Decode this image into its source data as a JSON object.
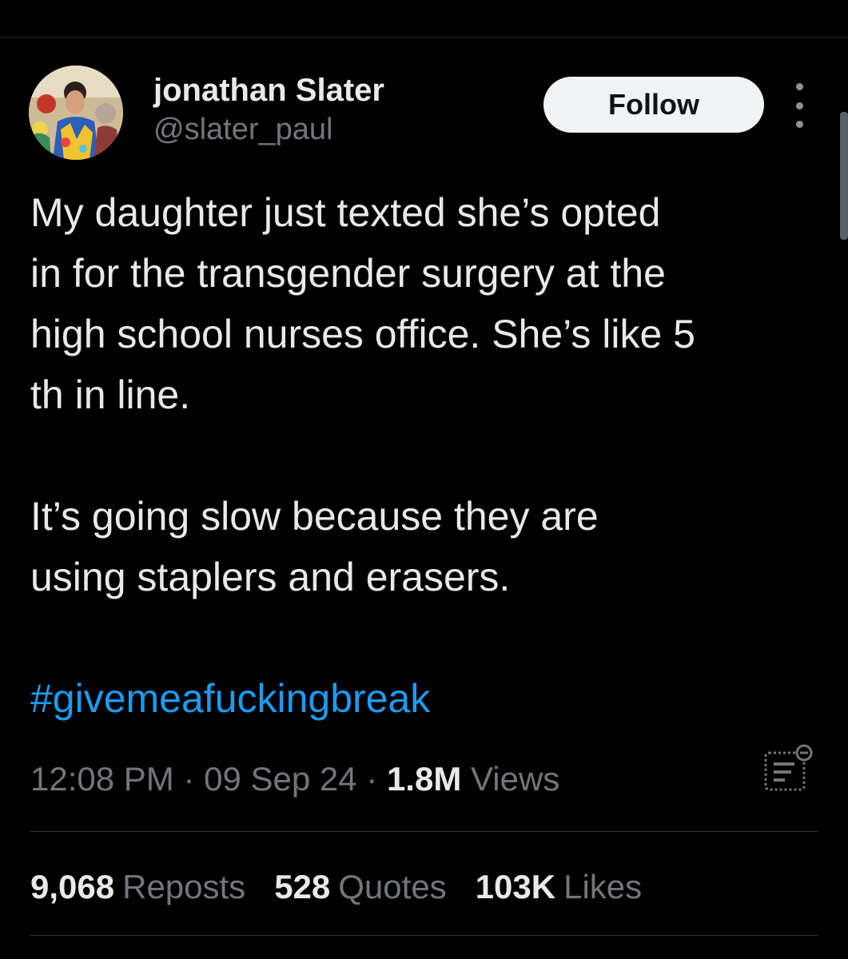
{
  "author": {
    "display_name": "jonathan Slater",
    "handle": "@slater_paul"
  },
  "header": {
    "follow_label": "Follow",
    "more_icon": "more-options-vertical-dots-icon"
  },
  "tweet": {
    "paragraph1": "My daughter just texted she’s opted\nin for the transgender surgery at the\nhigh school nurses office. She’s like 5\nth in line.",
    "paragraph2": "It’s going slow because they are\nusing staplers and erasers.",
    "hashtag": "#givemeafuckingbreak"
  },
  "meta": {
    "time": "12:08 PM",
    "separator": " · ",
    "date": "09 Sep 24",
    "views_count": "1.8M",
    "views_label": "Views",
    "analytics_icon": "post-analytics-icon"
  },
  "stats": {
    "reposts_count": "9,068",
    "reposts_label": "Reposts",
    "quotes_count": "528",
    "quotes_label": "Quotes",
    "likes_count": "103K",
    "likes_label": "Likes"
  },
  "colors": {
    "background": "#000000",
    "text_primary": "#e7e9ea",
    "text_secondary": "#71767b",
    "link": "#1d9bf0",
    "follow_button_bg": "#eff3f4",
    "follow_button_text": "#0f1419"
  }
}
